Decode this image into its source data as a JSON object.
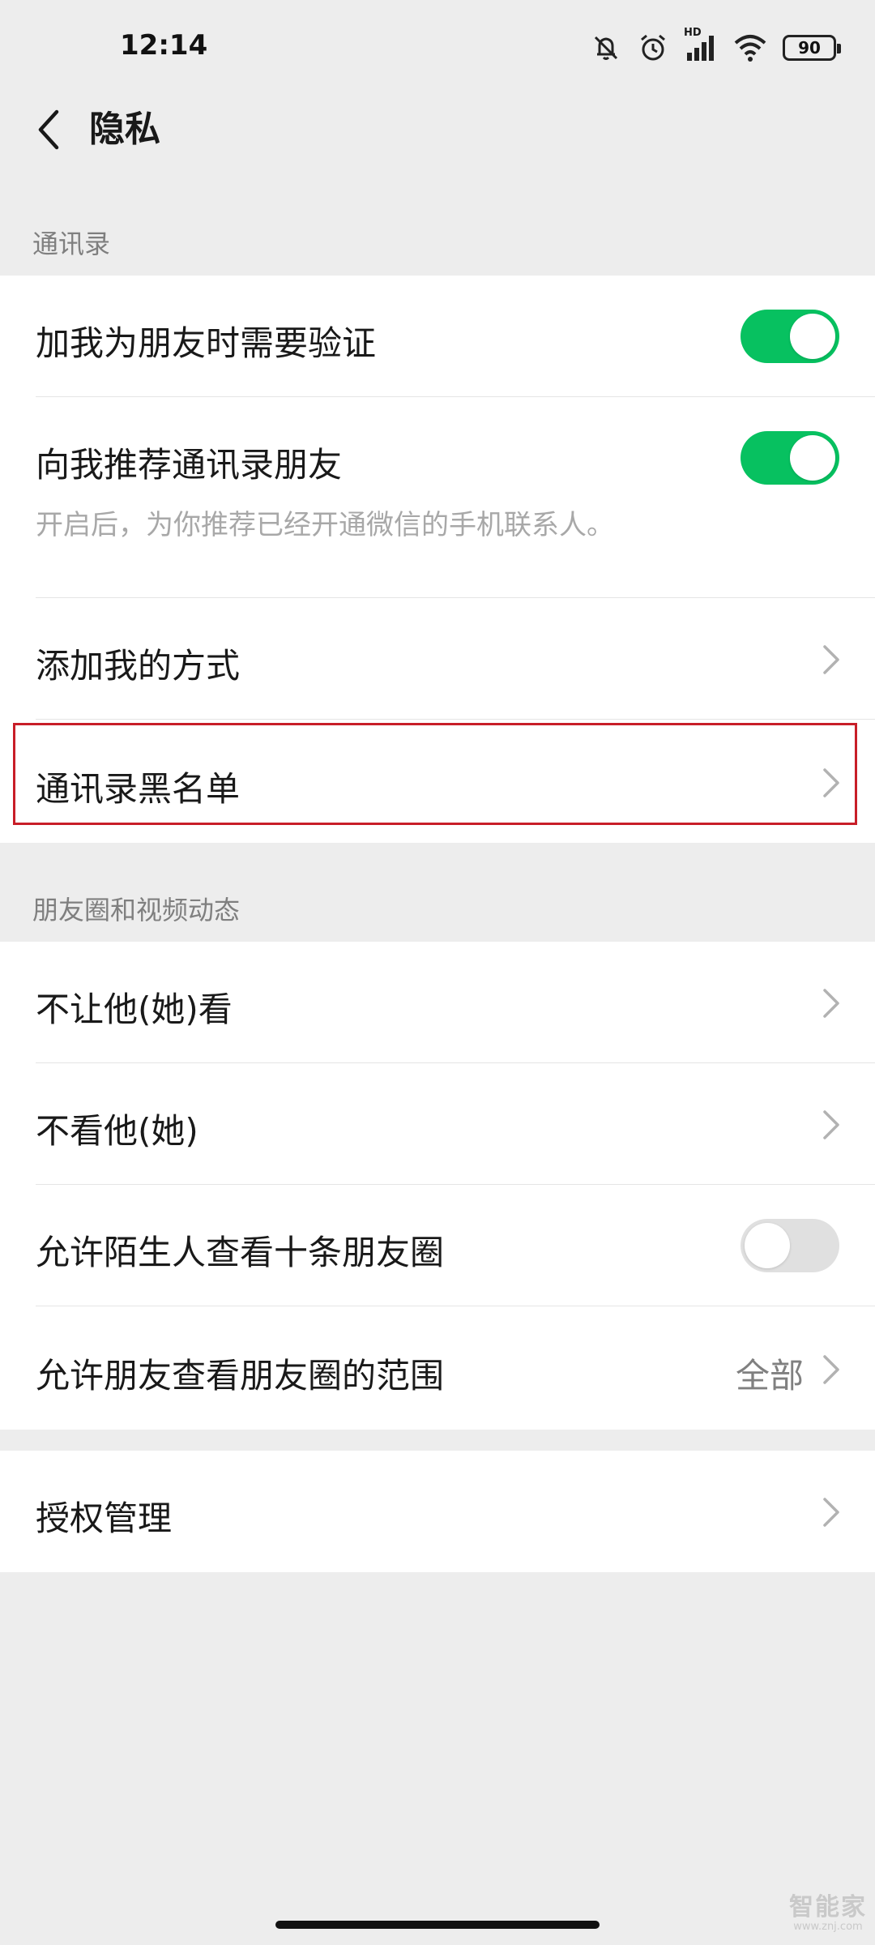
{
  "status_bar": {
    "time": "12:14",
    "hd_label": "HD",
    "battery_level": "90",
    "icons": [
      "mute-bell-icon",
      "alarm-icon",
      "cellular-signal-icon",
      "wifi-icon",
      "battery-icon"
    ]
  },
  "nav": {
    "title": "隐私",
    "back_icon": "chevron-left-icon"
  },
  "sections": {
    "contacts": {
      "header": "通讯录",
      "items": [
        {
          "label": "加我为朋友时需要验证",
          "toggle": true
        },
        {
          "label": "向我推荐通讯录朋友",
          "toggle": true,
          "description": "开启后，为你推荐已经开通微信的手机联系人。"
        },
        {
          "label": "添加我的方式"
        },
        {
          "label": "通讯录黑名单"
        }
      ]
    },
    "moments": {
      "header": "朋友圈和视频动态",
      "items": [
        {
          "label": "不让他(她)看"
        },
        {
          "label": "不看他(她)"
        },
        {
          "label": "允许陌生人查看十条朋友圈",
          "toggle": false
        },
        {
          "label": "允许朋友查看朋友圈的范围",
          "value": "全部"
        }
      ]
    },
    "other": {
      "items": [
        {
          "label": "授权管理"
        }
      ]
    }
  },
  "watermark": {
    "main": "智能家",
    "sub": "www.znj.com"
  },
  "colors": {
    "accent_green": "#07c160",
    "highlight_red": "#c81e28",
    "background": "#ededed"
  }
}
